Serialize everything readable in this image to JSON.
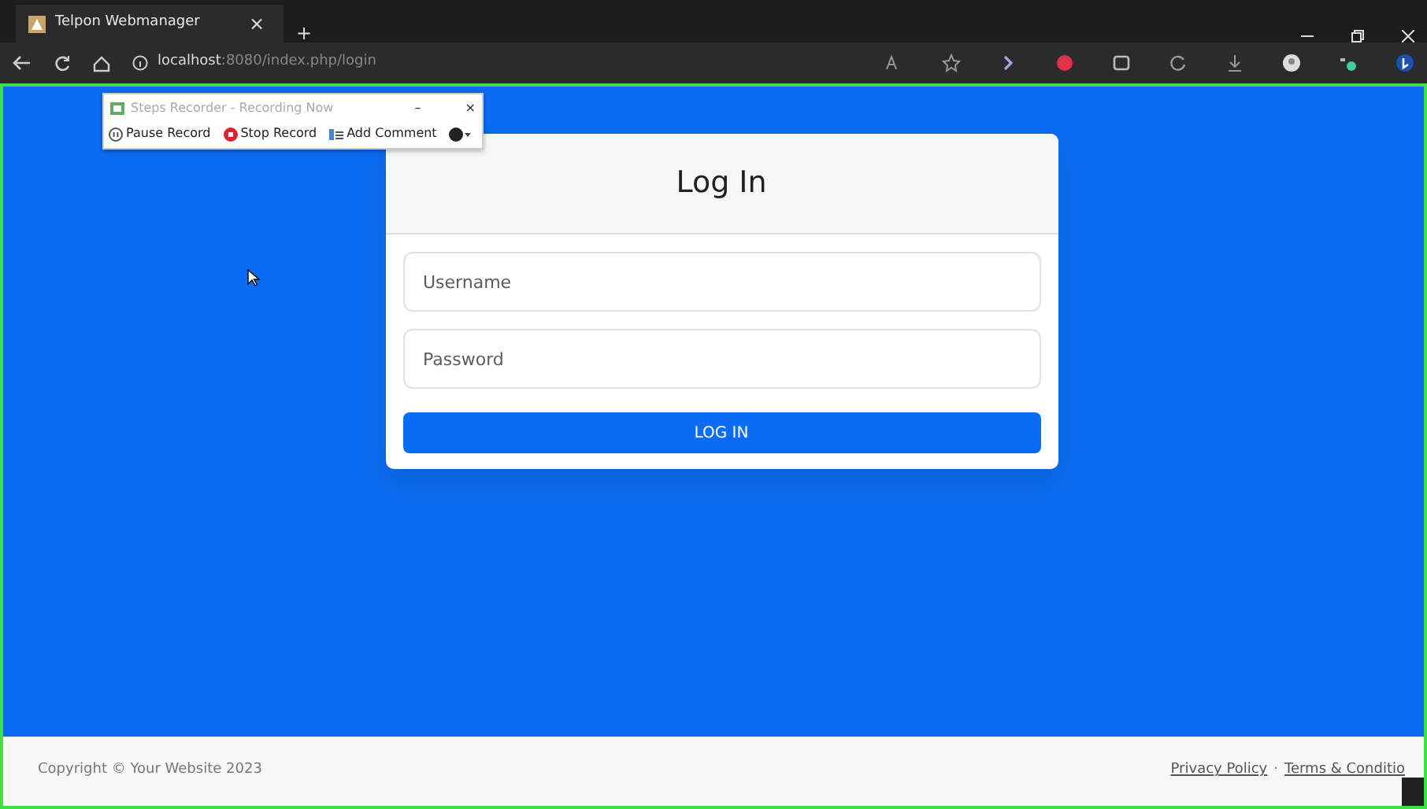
{
  "browser": {
    "tab_title": "Telpon Webmanager",
    "tab_close": "×",
    "new_tab": "+",
    "address_host": "localhost",
    "address_path": ":8080/index.php/login"
  },
  "recorder": {
    "title": "Steps Recorder - Recording Now",
    "minimize": "–",
    "close": "×",
    "buttons": [
      {
        "label": "Pause Record",
        "kind": "pause"
      },
      {
        "label": "Stop Record",
        "kind": "stop"
      },
      {
        "label": "Add Comment",
        "kind": "comment"
      }
    ]
  },
  "login": {
    "title": "Log In",
    "fields": [
      {
        "placeholder": "Username"
      },
      {
        "placeholder": "Password"
      }
    ],
    "button": "LOG IN"
  },
  "footer": {
    "copyright": "Copyright © Your Website 2023",
    "links": [
      {
        "label": "Privacy Policy"
      },
      {
        "label": "Terms & Conditio"
      }
    ],
    "separator": "·"
  }
}
